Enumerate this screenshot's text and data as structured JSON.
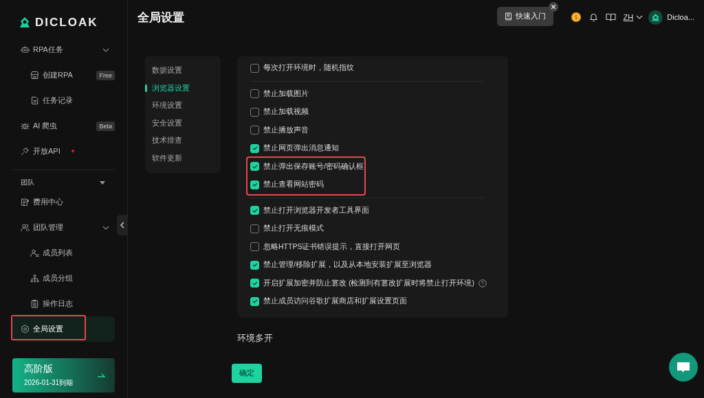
{
  "logo": {
    "text": "DICLOAK"
  },
  "sidebar": {
    "items": [
      {
        "label": "RPA任务",
        "kind": "group",
        "expanded": true,
        "children": [
          {
            "label": "创建RPA",
            "badge": "Free",
            "selected": false,
            "highlighted": false
          },
          {
            "label": "任务记录",
            "selected": false,
            "highlighted": false
          }
        ]
      },
      {
        "label": "AI 爬虫",
        "kind": "item",
        "badge": "Beta",
        "selected": false,
        "highlighted": false
      },
      {
        "label": "开放API",
        "kind": "item",
        "dot": true,
        "selected": false,
        "highlighted": false
      },
      {
        "label": "团队",
        "kind": "section",
        "expanded": true
      },
      {
        "label": "费用中心",
        "kind": "item",
        "selected": false,
        "highlighted": false
      },
      {
        "label": "团队管理",
        "kind": "group",
        "expanded": true,
        "children": [
          {
            "label": "成员列表",
            "selected": false,
            "highlighted": false
          },
          {
            "label": "成员分组",
            "selected": false,
            "highlighted": false
          },
          {
            "label": "操作日志",
            "selected": false,
            "highlighted": false
          }
        ]
      },
      {
        "label": "全局设置",
        "kind": "item",
        "selected": true,
        "highlighted": true
      }
    ]
  },
  "plan": {
    "name": "高阶版",
    "expiry": "2026-01-31到期"
  },
  "header": {
    "title": "全局设置",
    "quick_start": "快速入门",
    "language": "ZH",
    "user": "Dicloa..."
  },
  "settings_nav": {
    "items": [
      {
        "label": "数据设置",
        "selected": false
      },
      {
        "label": "浏览器设置",
        "selected": true
      },
      {
        "label": "环境设置",
        "selected": false
      },
      {
        "label": "安全设置",
        "selected": false
      },
      {
        "label": "技术排查",
        "selected": false
      },
      {
        "label": "软件更新",
        "selected": false
      }
    ]
  },
  "option_groups": [
    {
      "items": [
        {
          "label": "每次打开环境时，随机指纹",
          "checked": false,
          "highlighted": false
        }
      ]
    },
    {
      "items": [
        {
          "label": "禁止加载图片",
          "checked": false,
          "highlighted": false
        },
        {
          "label": "禁止加载视频",
          "checked": false,
          "highlighted": false
        },
        {
          "label": "禁止播放声音",
          "checked": false,
          "highlighted": false
        },
        {
          "label": "禁止网页弹出消息通知",
          "checked": true,
          "highlighted": false
        },
        {
          "label": "禁止弹出保存账号/密码确认框",
          "checked": true,
          "highlighted": true
        },
        {
          "label": "禁止查看网站密码",
          "checked": true,
          "highlighted": true
        }
      ]
    },
    {
      "items": [
        {
          "label": "禁止打开浏览器开发者工具界面",
          "checked": true,
          "highlighted": false
        },
        {
          "label": "禁止打开无痕模式",
          "checked": false,
          "highlighted": false
        },
        {
          "label": "忽略HTTPS证书错误提示，直接打开网页",
          "checked": false,
          "highlighted": false
        },
        {
          "label": "禁止管理/移除扩展，以及从本地安装扩展至浏览器",
          "checked": true,
          "highlighted": false
        },
        {
          "label": "开启扩展加密并防止篡改 (检测到有篡改扩展时将禁止打开环境)",
          "checked": true,
          "help": true,
          "highlighted": false
        },
        {
          "label": "禁止成员访问谷歌扩展商店和扩展设置页面",
          "checked": true,
          "highlighted": false
        }
      ]
    }
  ],
  "section_title": "环境多开",
  "confirm_button": "确定"
}
